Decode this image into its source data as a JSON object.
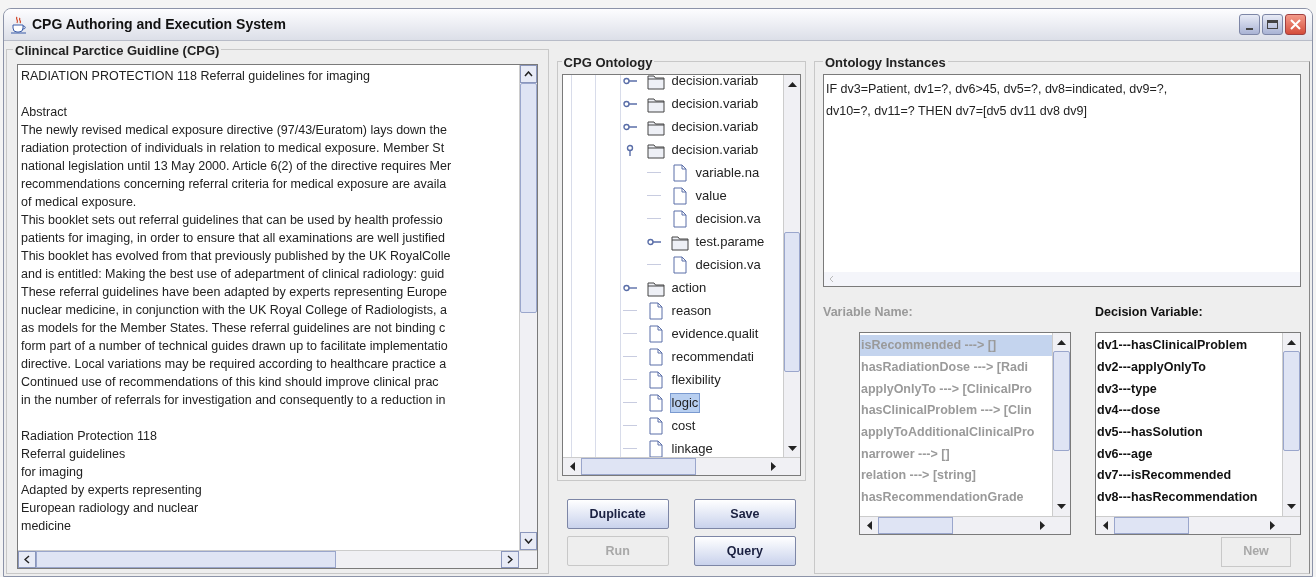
{
  "window": {
    "title": "CPG Authoring and Execution System"
  },
  "guideline_panel": {
    "title": "Clinincal Parctice Guidline (CPG)",
    "blocks": [
      [
        "RADIATION PROTECTION 118 Referral guidelines for imaging"
      ],
      [
        "Abstract",
        "The newly revised medical exposure directive (97/43/Euratom) lays down the",
        "radiation protection of individuals in relation to medical exposure. Member St",
        "national legislation until 13 May 2000. Article 6(2) of the directive requires Mer",
        "recommendations concerning referral criteria for medical exposure are availa",
        "of medical exposure.",
        "This booklet sets out referral guidelines that can be used by health professio",
        "patients for imaging, in order to ensure that all examinations are well justified",
        "This booklet has evolved from that previously published by the UK RoyalColle",
        "and is entitled: Making the best use of adepartment of clinical radiology: guid",
        "These referral guidelines have been adapted by experts representing Europe",
        "nuclear medicine, in conjunction with the UK Royal College of Radiologists, a",
        "as models for the Member States. These referral guidelines are not binding c",
        "form part of a number of technical guides drawn up to facilitate implementatio",
        "directive. Local variations may be required according to healthcare practice a",
        "Continued use of recommendations of this kind should improve clinical prac",
        "in the number of referrals for investigation and consequently to a reduction in"
      ],
      [
        "Radiation Protection 118",
        "Referral guidelines",
        "for imaging",
        "Adapted by experts representing",
        "European radiology and nuclear",
        "medicine"
      ]
    ]
  },
  "ontology_panel": {
    "title": "CPG Ontology",
    "tree": [
      {
        "label": "decision.variab",
        "kind": "folder",
        "expanded": false,
        "selected": false
      },
      {
        "label": "decision.variab",
        "kind": "folder",
        "expanded": false,
        "selected": false
      },
      {
        "label": "decision.variab",
        "kind": "folder",
        "expanded": false,
        "selected": false
      },
      {
        "label": "decision.variab",
        "kind": "folder",
        "expanded": true,
        "selected": false,
        "children": [
          {
            "label": "variable.na",
            "kind": "leaf",
            "selected": false
          },
          {
            "label": "value",
            "kind": "leaf",
            "selected": false
          },
          {
            "label": "decision.va",
            "kind": "leaf",
            "selected": false
          },
          {
            "label": "test.parame",
            "kind": "folder",
            "expanded": false,
            "selected": false
          },
          {
            "label": "decision.va",
            "kind": "leaf",
            "selected": false
          }
        ]
      },
      {
        "label": "action",
        "kind": "folder",
        "expanded": false,
        "selected": false
      },
      {
        "label": "reason",
        "kind": "leaf",
        "selected": false
      },
      {
        "label": "evidence.qualit",
        "kind": "leaf",
        "selected": false
      },
      {
        "label": "recommendati",
        "kind": "leaf",
        "selected": false
      },
      {
        "label": "flexibility",
        "kind": "leaf",
        "selected": false
      },
      {
        "label": "logic",
        "kind": "leaf",
        "selected": true
      },
      {
        "label": "cost",
        "kind": "leaf",
        "selected": false
      },
      {
        "label": "linkage",
        "kind": "leaf",
        "selected": false
      }
    ]
  },
  "buttons": [
    {
      "label": "Duplicate",
      "disabled": false
    },
    {
      "label": "Save",
      "disabled": false
    },
    {
      "label": "Run",
      "disabled": true
    },
    {
      "label": "Query",
      "disabled": false
    }
  ],
  "instances_panel": {
    "title": "Ontology Instances",
    "lines": [
      "IF dv3=Patient, dv1=?, dv6>45, dv5=?, dv8=indicated, dv9=?,",
      "dv10=?, dv11=? THEN dv7=[dv5 dv11 dv8 dv9]"
    ]
  },
  "variable_name": {
    "label": "Variable Name:",
    "disabled": true,
    "items": [
      {
        "text": "isRecommended ---> []",
        "selected": true
      },
      {
        "text": "hasRadiationDose ---> [Radi",
        "selected": false
      },
      {
        "text": "applyOnlyTo ---> [ClinicalPro",
        "selected": false
      },
      {
        "text": "hasClinicalProblem ---> [Clin",
        "selected": false
      },
      {
        "text": "applyToAdditionalClinicalPro",
        "selected": false
      },
      {
        "text": "narrower ---> []",
        "selected": false
      },
      {
        "text": "relation ---> [string]",
        "selected": false
      },
      {
        "text": "hasRecommendationGrade",
        "selected": false
      }
    ]
  },
  "decision_variable": {
    "label": "Decision Variable:",
    "disabled": false,
    "items": [
      {
        "text": "dv1---hasClinicalProblem",
        "selected": false
      },
      {
        "text": "dv2---applyOnlyTo",
        "selected": false
      },
      {
        "text": "dv3---type",
        "selected": false
      },
      {
        "text": "dv4---dose",
        "selected": false
      },
      {
        "text": "dv5---hasSolution",
        "selected": false
      },
      {
        "text": "dv6---age",
        "selected": false
      },
      {
        "text": "dv7---isRecommended",
        "selected": false
      },
      {
        "text": "dv8---hasRecommendation",
        "selected": false
      }
    ]
  },
  "new_button": {
    "label": "New",
    "disabled": true
  }
}
